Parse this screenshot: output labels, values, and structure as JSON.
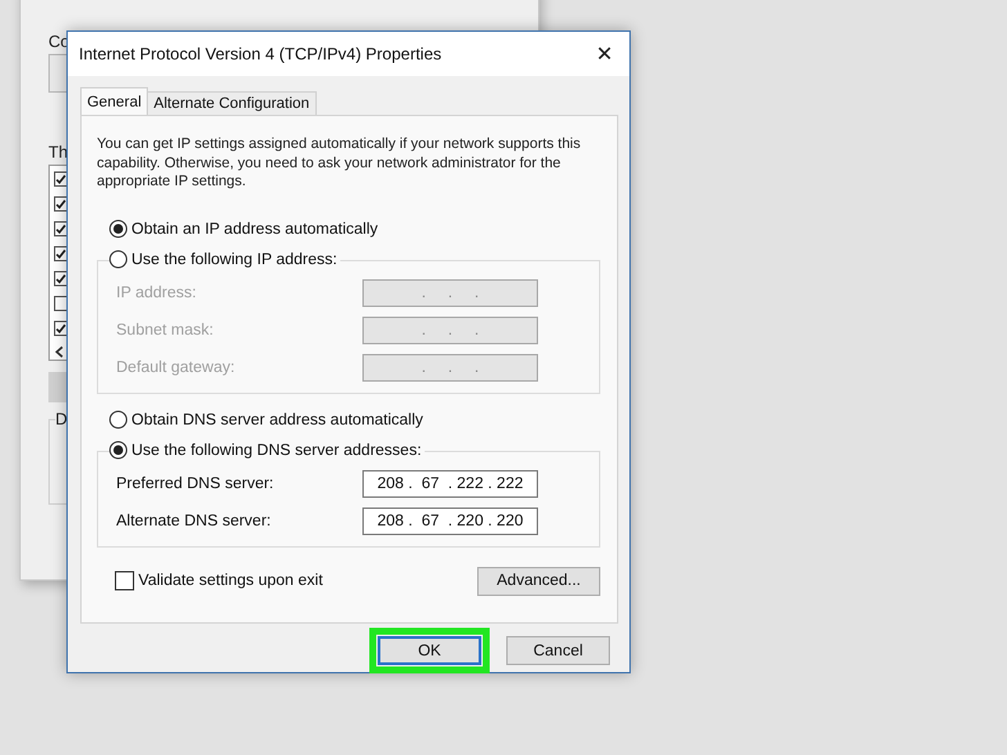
{
  "background_window": {
    "labels": [
      {
        "kind": "label",
        "text": "Co"
      },
      {
        "kind": "field"
      },
      {
        "kind": "label",
        "text": "Th"
      },
      {
        "kind": "list"
      },
      {
        "kind": "button"
      },
      {
        "kind": "group",
        "text": "D"
      }
    ],
    "items": [
      {
        "checked": true
      },
      {
        "checked": true
      },
      {
        "checked": true
      },
      {
        "checked": true
      },
      {
        "checked": true
      },
      {
        "checked": false
      },
      {
        "checked": true
      }
    ]
  },
  "dialog": {
    "title": "Internet Protocol Version 4 (TCP/IPv4) Properties",
    "close": "✕",
    "tabs": [
      {
        "label": "General",
        "selected": true
      },
      {
        "label": "Alternate Configuration",
        "selected": false
      }
    ],
    "intro": "You can get IP settings assigned automatically if your network supports this capability. Otherwise, you need to ask your network administrator for the appropriate IP settings.",
    "sections": [
      {
        "options": [
          {
            "label": "Obtain an IP address automatically",
            "selected": true
          },
          {
            "label": "Use the following IP address:",
            "selected": false
          }
        ],
        "fields": [
          {
            "label": "IP address:",
            "value": "  .     .     .  ",
            "disabled": true
          },
          {
            "label": "Subnet mask:",
            "value": "  .     .     .  ",
            "disabled": true
          },
          {
            "label": "Default gateway:",
            "value": "  .     .     .  ",
            "disabled": true
          }
        ]
      },
      {
        "options": [
          {
            "label": "Obtain DNS server address automatically",
            "selected": false
          },
          {
            "label": "Use the following DNS server addresses:",
            "selected": true
          }
        ],
        "fields": [
          {
            "label": "Preferred DNS server:",
            "value": "208 .  67  . 222 . 222",
            "disabled": false
          },
          {
            "label": "Alternate DNS server:",
            "value": "208 .  67  . 220 . 220",
            "disabled": false
          }
        ]
      }
    ],
    "validate": {
      "label": "Validate settings upon exit",
      "checked": false
    },
    "advanced": "Advanced...",
    "buttons": [
      {
        "label": "OK",
        "highlighted": true
      },
      {
        "label": "Cancel",
        "highlighted": false
      }
    ]
  }
}
